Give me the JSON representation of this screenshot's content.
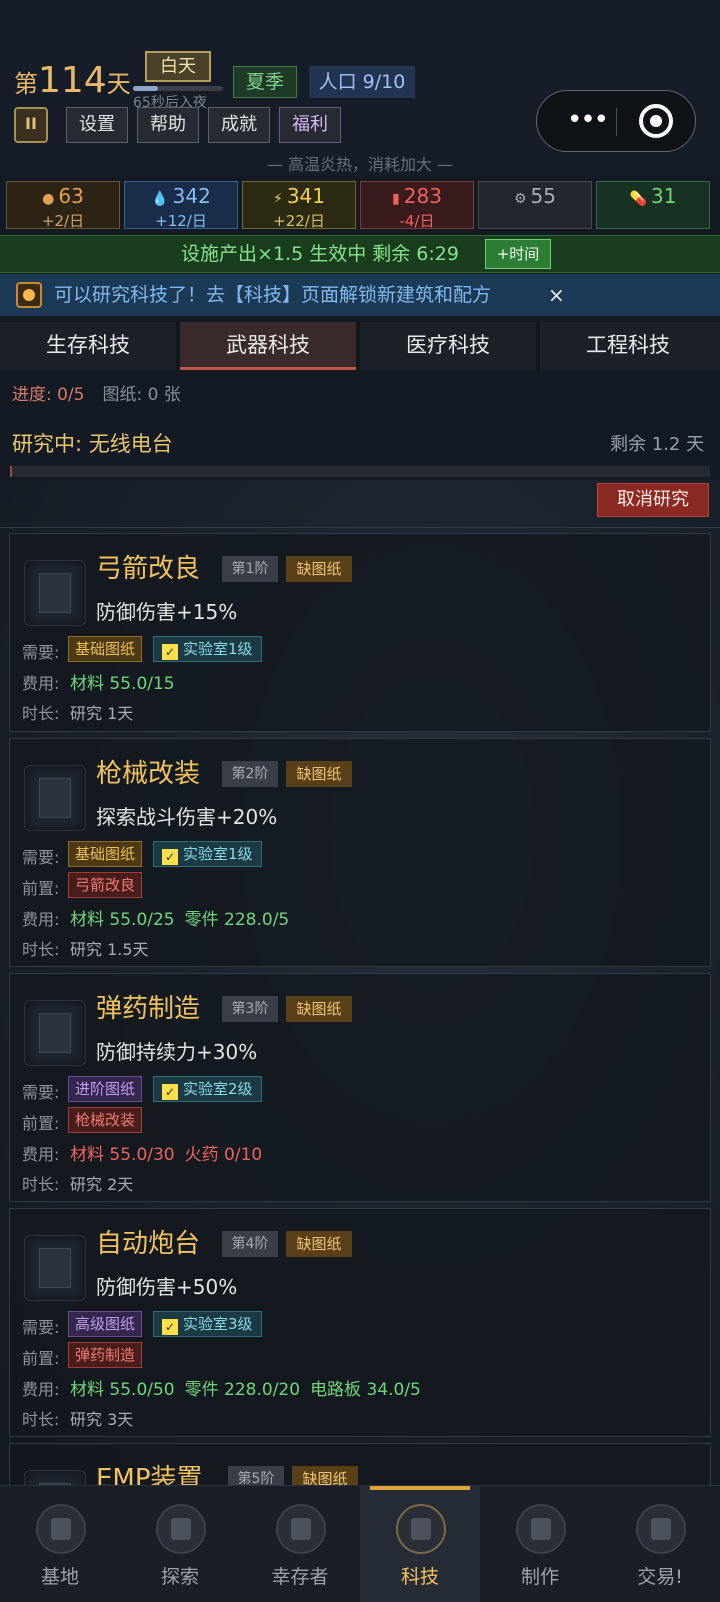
{
  "status": {
    "day_prefix": "第",
    "day_number": "114",
    "day_suffix": "天",
    "phase": "白天",
    "phase_progress": 0.28,
    "phase_hint": "65秒后入夜",
    "season": "夏季",
    "population": "人口 9/10"
  },
  "menu": {
    "settings": "设置",
    "help": "帮助",
    "achievements": "成就",
    "welfare": "福利"
  },
  "capsule": {
    "more": "•••"
  },
  "weather_notice": "— 高温炎热，消耗加大 —",
  "resources": [
    {
      "icon": "food-icon",
      "glyph": "●",
      "value": "63",
      "rate": "+2/日",
      "color": "#e0a24f",
      "bg": "#2e2415",
      "border": "#6a5434",
      "rate_color": "#c9a56a"
    },
    {
      "icon": "water-icon",
      "glyph": "💧",
      "value": "342",
      "rate": "+12/日",
      "color": "#86bff4",
      "bg": "#192d49",
      "border": "#3b5f8f",
      "rate_color": "#86bff4"
    },
    {
      "icon": "energy-icon",
      "glyph": "⚡",
      "value": "341",
      "rate": "+22/日",
      "color": "#f2cf52",
      "bg": "#2d2a14",
      "border": "#6e6a34",
      "rate_color": "#d8c070"
    },
    {
      "icon": "medicine-icon",
      "glyph": "▮",
      "value": "283",
      "rate": "-4/日",
      "color": "#f0625b",
      "bg": "#3a1b1d",
      "border": "#7e3a3a",
      "rate_color": "#f0625b"
    },
    {
      "icon": "gear-icon",
      "glyph": "⚙",
      "value": "55",
      "rate": "",
      "color": "#a7acb4",
      "bg": "#22262d",
      "border": "#44494f",
      "rate_color": "#a7acb4"
    },
    {
      "icon": "pill-icon",
      "glyph": "💊",
      "value": "31",
      "rate": "",
      "color": "#6fd67a",
      "bg": "#173123",
      "border": "#34694a",
      "rate_color": "#6fd67a"
    }
  ],
  "bonus": {
    "text": "设施产出×1.5 生效中  剩余 6:29",
    "button": "+时间"
  },
  "notice": {
    "text": "可以研究科技了！去【科技】页面解锁新建筑和配方",
    "close": "×"
  },
  "tabs": [
    "生存科技",
    "武器科技",
    "医疗科技",
    "工程科技"
  ],
  "research": {
    "progress": "进度: 0/5",
    "blueprints": "图纸: 0 张",
    "current": "研究中: 无线电台",
    "remaining": "剩余 1.2 天",
    "percent": 0,
    "cancel": "取消研究"
  },
  "labels": {
    "req": "需要:",
    "pre": "前置:",
    "cost": "费用:",
    "dur": "时长:"
  },
  "techs": [
    {
      "name": "弓箭改良",
      "tier": "第1阶",
      "lack": "缺图纸",
      "effect": "防御伤害+15%",
      "blueprint": "基础图纸",
      "blueprint_kind": "basic",
      "lab": "实验室1级",
      "prereq": "",
      "costs": [
        {
          "text": "材料 55.0/15",
          "ok": true
        }
      ],
      "duration": "研究 1天"
    },
    {
      "name": "枪械改装",
      "tier": "第2阶",
      "lack": "缺图纸",
      "effect": "探索战斗伤害+20%",
      "blueprint": "基础图纸",
      "blueprint_kind": "basic",
      "lab": "实验室1级",
      "prereq": "弓箭改良",
      "costs": [
        {
          "text": "材料 55.0/25",
          "ok": true
        },
        {
          "text": "零件 228.0/5",
          "ok": true
        }
      ],
      "duration": "研究 1.5天"
    },
    {
      "name": "弹药制造",
      "tier": "第3阶",
      "lack": "缺图纸",
      "effect": "防御持续力+30%",
      "blueprint": "进阶图纸",
      "blueprint_kind": "adv",
      "lab": "实验室2级",
      "prereq": "枪械改装",
      "costs": [
        {
          "text": "材料 55.0/30",
          "ok": false
        },
        {
          "text": "火药 0/10",
          "ok": false
        }
      ],
      "duration": "研究 2天"
    },
    {
      "name": "自动炮台",
      "tier": "第4阶",
      "lack": "缺图纸",
      "effect": "防御伤害+50%",
      "blueprint": "高级图纸",
      "blueprint_kind": "adv",
      "lab": "实验室3级",
      "prereq": "弹药制造",
      "costs": [
        {
          "text": "材料 55.0/50",
          "ok": true
        },
        {
          "text": "零件 228.0/20",
          "ok": true
        },
        {
          "text": "电路板 34.0/5",
          "ok": true
        }
      ],
      "duration": "研究 3天"
    },
    {
      "name": "EMP装置",
      "tier": "第5阶",
      "lack": "缺图纸",
      "effect": "",
      "blueprint": "",
      "blueprint_kind": "",
      "lab": "",
      "prereq": "",
      "costs": [],
      "duration": ""
    }
  ],
  "nav": [
    {
      "label": "基地",
      "icon": "base-icon",
      "active": false
    },
    {
      "label": "探索",
      "icon": "compass-icon",
      "active": false
    },
    {
      "label": "幸存者",
      "icon": "survivors-icon",
      "active": false
    },
    {
      "label": "科技",
      "icon": "tech-icon",
      "active": true
    },
    {
      "label": "制作",
      "icon": "craft-icon",
      "active": false
    },
    {
      "label": "交易!",
      "icon": "trade-icon",
      "active": false
    }
  ]
}
